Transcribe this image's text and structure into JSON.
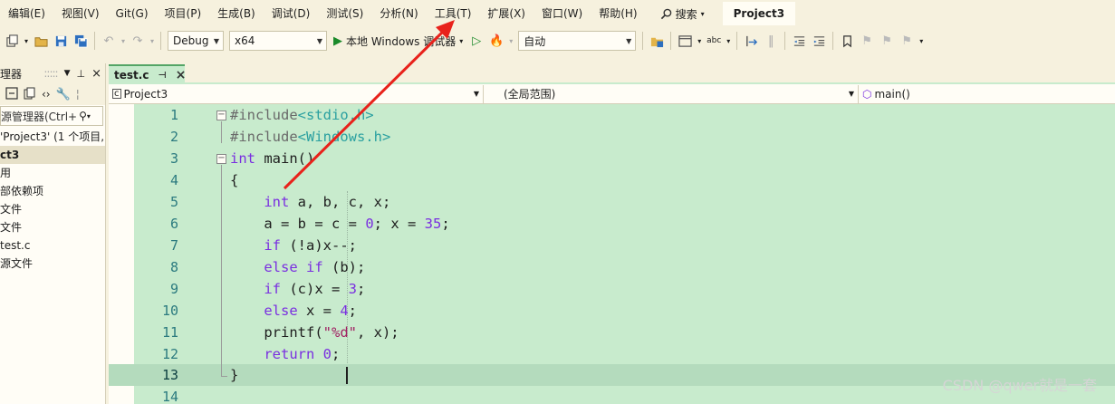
{
  "menubar": {
    "items": [
      "编辑(E)",
      "视图(V)",
      "Git(G)",
      "项目(P)",
      "生成(B)",
      "调试(D)",
      "测试(S)",
      "分析(N)",
      "工具(T)",
      "扩展(X)",
      "窗口(W)",
      "帮助(H)"
    ],
    "search_label": "搜索",
    "project_title": "Project3"
  },
  "toolbar": {
    "config": "Debug",
    "platform": "x64",
    "run_label": "本地 Windows 调试器",
    "auto": "自动"
  },
  "solution_explorer": {
    "title": "理器",
    "search_placeholder": "源管理器(Ctrl+",
    "nodes": [
      {
        "label": "'Project3' (1 个项目,",
        "selected": false
      },
      {
        "label": "ct3",
        "selected": true
      },
      {
        "label": "用",
        "selected": false
      },
      {
        "label": "部依赖项",
        "selected": false
      },
      {
        "label": "文件",
        "selected": false
      },
      {
        "label": "文件",
        "selected": false
      },
      {
        "label": " test.c",
        "selected": false
      },
      {
        "label": "源文件",
        "selected": false
      }
    ]
  },
  "editor": {
    "tab_label": "test.c",
    "nav_project": "Project3",
    "nav_scope": "(全局范围)",
    "nav_member": "main()",
    "lines": [
      {
        "n": "1",
        "code": "#include<stdio.h>"
      },
      {
        "n": "2",
        "code": "#include<Windows.h>"
      },
      {
        "n": "3",
        "code": "int main()"
      },
      {
        "n": "4",
        "code": "{"
      },
      {
        "n": "5",
        "code": "    int a, b, c, x;"
      },
      {
        "n": "6",
        "code": "    a = b = c = 0; x = 35;"
      },
      {
        "n": "7",
        "code": "    if (!a)x--;"
      },
      {
        "n": "8",
        "code": "    else if (b);"
      },
      {
        "n": "9",
        "code": "    if (c)x = 3;"
      },
      {
        "n": "10",
        "code": "    else x = 4;"
      },
      {
        "n": "11",
        "code": "    printf(\"%d\", x);"
      },
      {
        "n": "12",
        "code": "    return 0;"
      },
      {
        "n": "13",
        "code": "}"
      },
      {
        "n": "14",
        "code": ""
      }
    ],
    "current_line": 13
  },
  "colors": {
    "code_bg": "#c8ebcd",
    "current_line_bg": "#b4dbbd",
    "chrome_bg": "#f6f1de",
    "annotation_arrow": "#e8221b"
  },
  "watermark": "CSDN @qwer就是一套"
}
